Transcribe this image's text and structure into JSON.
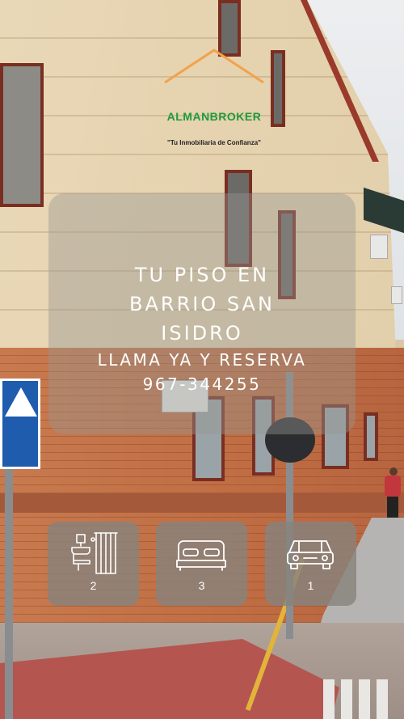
{
  "brand": {
    "name": "ALMANBROKER",
    "slogan": "\"Tu Inmobiliaria de Confianza\"",
    "name_color": "#1e9b3c",
    "logo_color": "#f2a24b"
  },
  "listing": {
    "headline_lines": [
      "TU PISO EN",
      "BARRIO SAN",
      "ISIDRO"
    ],
    "cta": "LLAMA YA Y RESERVA",
    "phone": "967-344255"
  },
  "features": [
    {
      "icon": "bathroom-icon",
      "count": "2"
    },
    {
      "icon": "bed-icon",
      "count": "3"
    },
    {
      "icon": "car-icon",
      "count": "1"
    }
  ]
}
